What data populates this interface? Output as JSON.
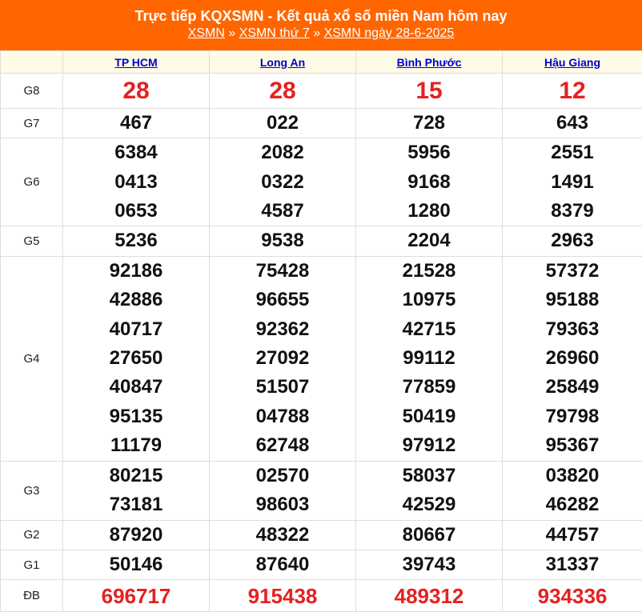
{
  "header": {
    "title": "Trực tiếp KQXSMN - Kết quả xổ số miền Nam hôm nay",
    "crumb1": "XSMN",
    "sep1": " » ",
    "crumb2": "XSMN thứ 7",
    "sep2": " » ",
    "crumb3": "XSMN ngày 28-6-2025"
  },
  "columns": [
    "TP HCM",
    "Long An",
    "Bình Phước",
    "Hậu Giang"
  ],
  "prizes": {
    "g8": {
      "label": "G8",
      "values": [
        "28",
        "28",
        "15",
        "12"
      ]
    },
    "g7": {
      "label": "G7",
      "values": [
        "467",
        "022",
        "728",
        "643"
      ]
    },
    "g6": {
      "label": "G6",
      "values": [
        [
          "6384",
          "0413",
          "0653"
        ],
        [
          "2082",
          "0322",
          "4587"
        ],
        [
          "5956",
          "9168",
          "1280"
        ],
        [
          "2551",
          "1491",
          "8379"
        ]
      ]
    },
    "g5": {
      "label": "G5",
      "values": [
        "5236",
        "9538",
        "2204",
        "2963"
      ]
    },
    "g4": {
      "label": "G4",
      "values": [
        [
          "92186",
          "42886",
          "40717",
          "27650",
          "40847",
          "95135",
          "11179"
        ],
        [
          "75428",
          "96655",
          "92362",
          "27092",
          "51507",
          "04788",
          "62748"
        ],
        [
          "21528",
          "10975",
          "42715",
          "99112",
          "77859",
          "50419",
          "97912"
        ],
        [
          "57372",
          "95188",
          "79363",
          "26960",
          "25849",
          "79798",
          "95367"
        ]
      ]
    },
    "g3": {
      "label": "G3",
      "values": [
        [
          "80215",
          "73181"
        ],
        [
          "02570",
          "98603"
        ],
        [
          "58037",
          "42529"
        ],
        [
          "03820",
          "46282"
        ]
      ]
    },
    "g2": {
      "label": "G2",
      "values": [
        "87920",
        "48322",
        "80667",
        "44757"
      ]
    },
    "g1": {
      "label": "G1",
      "values": [
        "50146",
        "87640",
        "39743",
        "31337"
      ]
    },
    "db": {
      "label": "ĐB",
      "values": [
        "696717",
        "915438",
        "489312",
        "934336"
      ]
    }
  },
  "colors": {
    "banner": "#ff6600",
    "jackpot": "#e62020",
    "link": "#0000cc"
  }
}
